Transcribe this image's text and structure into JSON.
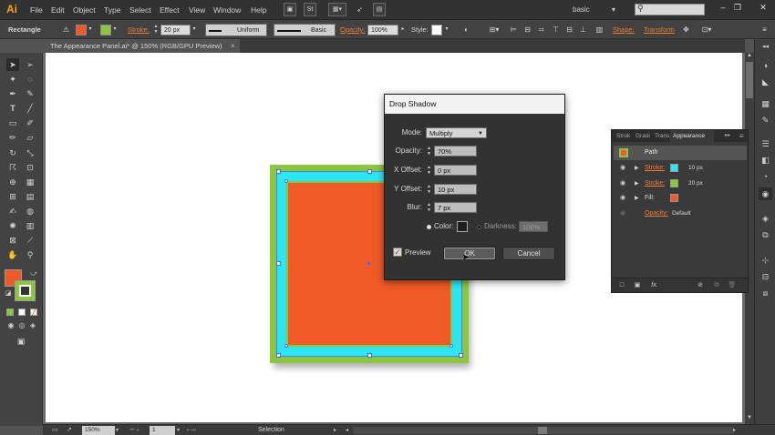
{
  "menubar": {
    "logo": "Ai",
    "items": [
      "File",
      "Edit",
      "Object",
      "Type",
      "Select",
      "Effect",
      "View",
      "Window",
      "Help"
    ],
    "doc_icon": "St",
    "workspace": "basic",
    "workspace_arrow": "▾",
    "window_buttons": [
      "–",
      "❐",
      "✕"
    ]
  },
  "controlbar": {
    "selection_label": "Rectangle",
    "fill_color": "#f05a28",
    "stroke_color": "#8cc63f",
    "stroke_label": "Stroke:",
    "stroke_weight": "20 px",
    "profile": "Uniform",
    "brush": "Basic",
    "opacity_label": "Opacity:",
    "opacity_value": "100%",
    "style_label": "Style:",
    "shape_label": "Shape:",
    "transform_label": "Transform"
  },
  "document": {
    "tab_title": "The Appearance Panel.ai* @ 150% (RGB/GPU Preview)",
    "close": "×"
  },
  "canvas": {
    "fill_color": "#f05a28",
    "stroke_outer_color": "#8cc63f",
    "stroke_inner_color": "#2ee6f2"
  },
  "dialog": {
    "title": "Drop Shadow",
    "mode_label": "Mode:",
    "mode_value": "Multiply",
    "opacity_label": "Opacity:",
    "opacity_value": "70%",
    "x_offset_label": "X Offset:",
    "x_offset_value": "0 px",
    "y_offset_label": "Y Offset:",
    "y_offset_value": "10 px",
    "blur_label": "Blur:",
    "blur_value": "7 px",
    "color_label": "Color:",
    "darkness_label": "Darkness:",
    "darkness_value": "100%",
    "preview_label": "Preview",
    "preview_checked": "✓",
    "ok_label": "OK",
    "cancel_label": "Cancel"
  },
  "appearance": {
    "tabs": [
      "Strok",
      "Gradi",
      "Trans",
      "Appearance"
    ],
    "tab_menu": "▸▸",
    "target": "Path",
    "rows": [
      {
        "name": "Stroke:",
        "swatch": "#2ee6f2",
        "value": "10 px"
      },
      {
        "name": "Stroke:",
        "swatch": "#8cc63f",
        "value": "20 px"
      },
      {
        "name": "Fill:",
        "swatch": "#f05a28",
        "value": ""
      }
    ],
    "opacity_name": "Opacity:",
    "opacity_value": "Default",
    "footer_fx": "fx."
  },
  "statusbar": {
    "zoom": "150%",
    "page": "1",
    "mode": "Selection"
  }
}
